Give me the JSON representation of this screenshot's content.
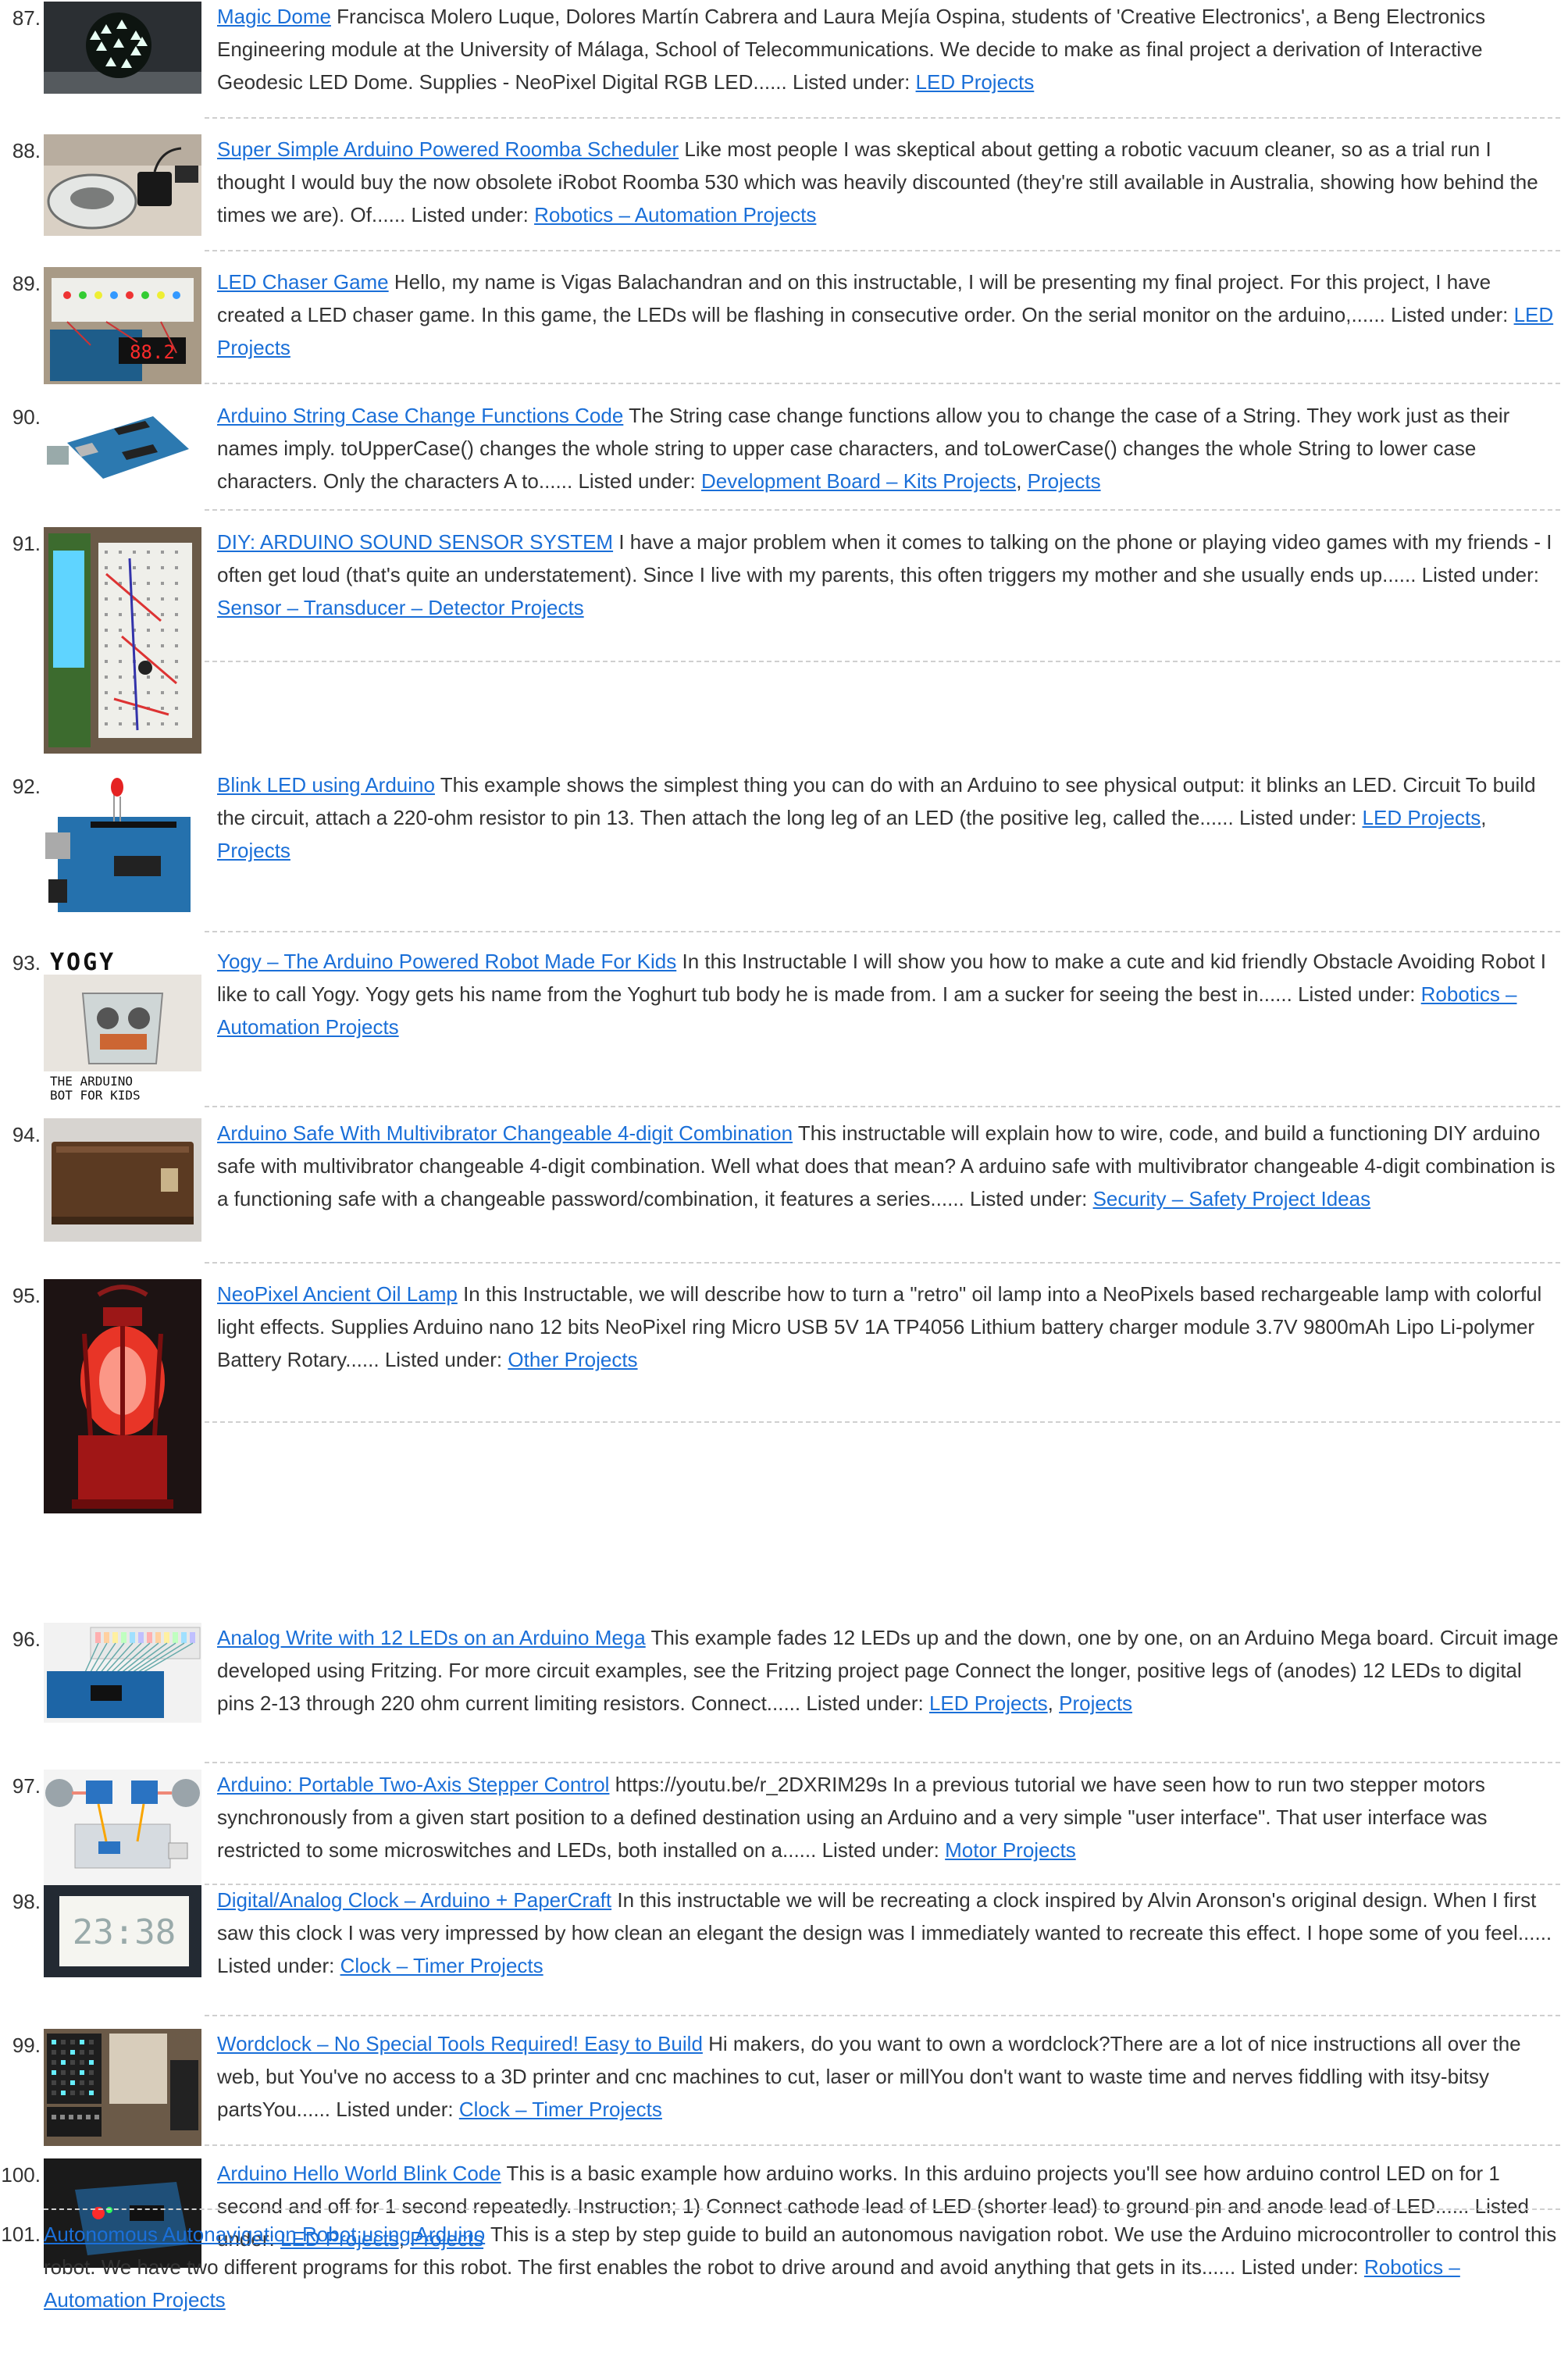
{
  "listed_under_label": "Listed under:",
  "entries": [
    {
      "num": "87.",
      "title": "Magic Dome",
      "excerpt": "Francisca Molero Luque, Dolores Martín Cabrera and Laura Mejía Ospina, students of 'Creative Electronics', a Beng Electronics Engineering module at the University of Málaga, School of Telecommunications. We decide to make as final project a derivation of Interactive Geodesic LED Dome. Supplies - NeoPixel Digital RGB LED......",
      "categories": [
        "LED Projects"
      ],
      "thumb": "dome"
    },
    {
      "num": "88.",
      "title": "Super Simple Arduino Powered Roomba Scheduler",
      "excerpt": "Like most people I was skeptical about getting a robotic vacuum cleaner, so as a trial run I thought I would buy the now obsolete iRobot Roomba 530 which was heavily discounted (they're still available in Australia, showing how behind the times we are). Of......",
      "categories": [
        "Robotics – Automation Projects"
      ],
      "thumb": "roomba"
    },
    {
      "num": "89.",
      "title": "LED Chaser Game",
      "excerpt": "Hello, my name is Vigas Balachandran and on this instructable, I will be presenting my final project. For this project, I have created a LED chaser game. In this game, the LEDs will be flashing in consecutive order. On the serial monitor on the arduino,......",
      "categories": [
        "LED Projects"
      ],
      "thumb": "breadboard"
    },
    {
      "num": "90.",
      "title": "Arduino String Case Change Functions Code",
      "excerpt": "The String case change functions allow you to change the case of a String. They work just as their names imply. toUpperCase() changes the whole string to upper case characters, and toLowerCase() changes the whole String to lower case characters. Only the characters A to......",
      "categories": [
        "Development Board – Kits Projects",
        "Projects"
      ],
      "thumb": "board"
    },
    {
      "num": "91.",
      "title": "DIY: ARDUINO SOUND SENSOR SYSTEM",
      "excerpt": "I have a major problem when it comes to talking on the phone or playing video games with my friends - I often get loud (that's quite an understatement). Since I live with my parents, this often triggers my mother and she usually ends up......",
      "categories": [
        "Sensor – Transducer – Detector Projects"
      ],
      "thumb": "sound"
    },
    {
      "num": "92.",
      "title": "Blink LED using Arduino",
      "excerpt": "This example shows the simplest thing you can do with an Arduino to see physical output: it blinks an LED. Circuit To build the circuit, attach a 220-ohm resistor to pin 13. Then attach the long leg of an LED (the positive leg, called the......",
      "categories": [
        "LED Projects",
        "Projects"
      ],
      "thumb": "blink"
    },
    {
      "num": "93.",
      "title": "Yogy – The Arduino Powered Robot Made For Kids",
      "excerpt": "In this Instructable I will show you how to make a cute and kid friendly Obstacle Avoiding Robot I like to call Yogy. Yogy gets his name from the Yoghurt tub body he is made from. I am a sucker for seeing the best in......",
      "categories": [
        "Robotics – Automation Projects"
      ],
      "thumb": "yogy",
      "thumb_text_top": "YOGY",
      "thumb_text_bottom_1": "THE ARDUINO",
      "thumb_text_bottom_2": "BOT FOR KIDS"
    },
    {
      "num": "94.",
      "title": "Arduino Safe With Multivibrator Changeable 4-digit Combination",
      "excerpt": "This instructable will explain how to wire, code, and build a functioning DIY arduino safe with multivibrator changeable 4-digit combination. Well what does that mean? A arduino safe with multivibrator changeable 4-digit combination is a functioning safe with a changeable password/combination, it features a series......",
      "categories": [
        "Security – Safety Project Ideas"
      ],
      "thumb": "safe"
    },
    {
      "num": "95.",
      "title": "NeoPixel Ancient Oil Lamp",
      "excerpt": "In this Instructable, we will describe how to turn a \"retro\" oil lamp into a NeoPixels based rechargeable lamp with colorful light effects. Supplies Arduino nano 12 bits NeoPixel ring Micro USB 5V 1A TP4056 Lithium battery charger module 3.7V 9800mAh Lipo Li-polymer Battery Rotary......",
      "categories": [
        "Other Projects"
      ],
      "thumb": "lamp"
    },
    {
      "num": "96.",
      "title": "Analog Write with 12 LEDs on an Arduino Mega",
      "excerpt": "This example fades 12 LEDs up and the down, one by one, on an Arduino Mega board. Circuit image developed using Fritzing. For more circuit examples, see the Fritzing project page Connect the longer, positive legs of (anodes) 12 LEDs to digital pins 2-13 through 220 ohm current limiting resistors. Connect......",
      "categories": [
        "LED Projects",
        "Projects"
      ],
      "thumb": "mega"
    },
    {
      "num": "97.",
      "title": "Arduino: Portable Two-Axis Stepper Control",
      "excerpt": "https://youtu.be/r_2DXRIM29s In a previous tutorial we have seen how to run two stepper motors synchronously from a given start position to a defined destination using an Arduino and a very simple \"user interface\". That user interface was restricted to some microswitches and LEDs, both installed on a......",
      "categories": [
        "Motor Projects"
      ],
      "thumb": "stepper"
    },
    {
      "num": "98.",
      "title": "Digital/Analog Clock – Arduino + PaperCraft",
      "excerpt": "In this instructable we will be recreating a clock inspired by Alvin Aronson's original design. When I first saw this clock I was very impressed by how clean an elegant the design was I immediately wanted to recreate this effect. I hope some of you feel......",
      "categories": [
        "Clock – Timer Projects"
      ],
      "thumb": "paperclock",
      "thumb_text_top": "23:38"
    },
    {
      "num": "99.",
      "title": "Wordclock – No Special Tools Required! Easy to Build",
      "excerpt": "Hi makers, do you want to own a wordclock?There are a lot of nice instructions all over the web, but You've no access to a 3D printer and cnc machines to cut, laser or millYou don't want to waste time and nerves fiddling with itsy-bitsy partsYou......",
      "categories": [
        "Clock – Timer Projects"
      ],
      "thumb": "wordclock"
    },
    {
      "num": "100.",
      "title": "Arduino Hello World Blink Code",
      "excerpt": "This is a basic example how arduino works. In this arduino projects you'll see how arduino control LED on for 1 second and off for 1 second repeatedly. Instruction; 1) Connect cathode lead of LED (shorter lead) to ground pin and anode lead of LED......",
      "categories": [
        "LED Projects",
        "Projects"
      ],
      "thumb": "hello"
    },
    {
      "num": "101.",
      "title": "Autonomous Autonavigation Robot using Arduino",
      "excerpt": "This is a step by step guide to build an autonomous navigation robot. We use the Arduino microcontroller to control this robot. We have two different programs for this robot. The first enables the robot to drive around and avoid anything that gets in its......",
      "categories": [
        "Robotics – Automation Projects"
      ],
      "thumb": "none"
    }
  ]
}
